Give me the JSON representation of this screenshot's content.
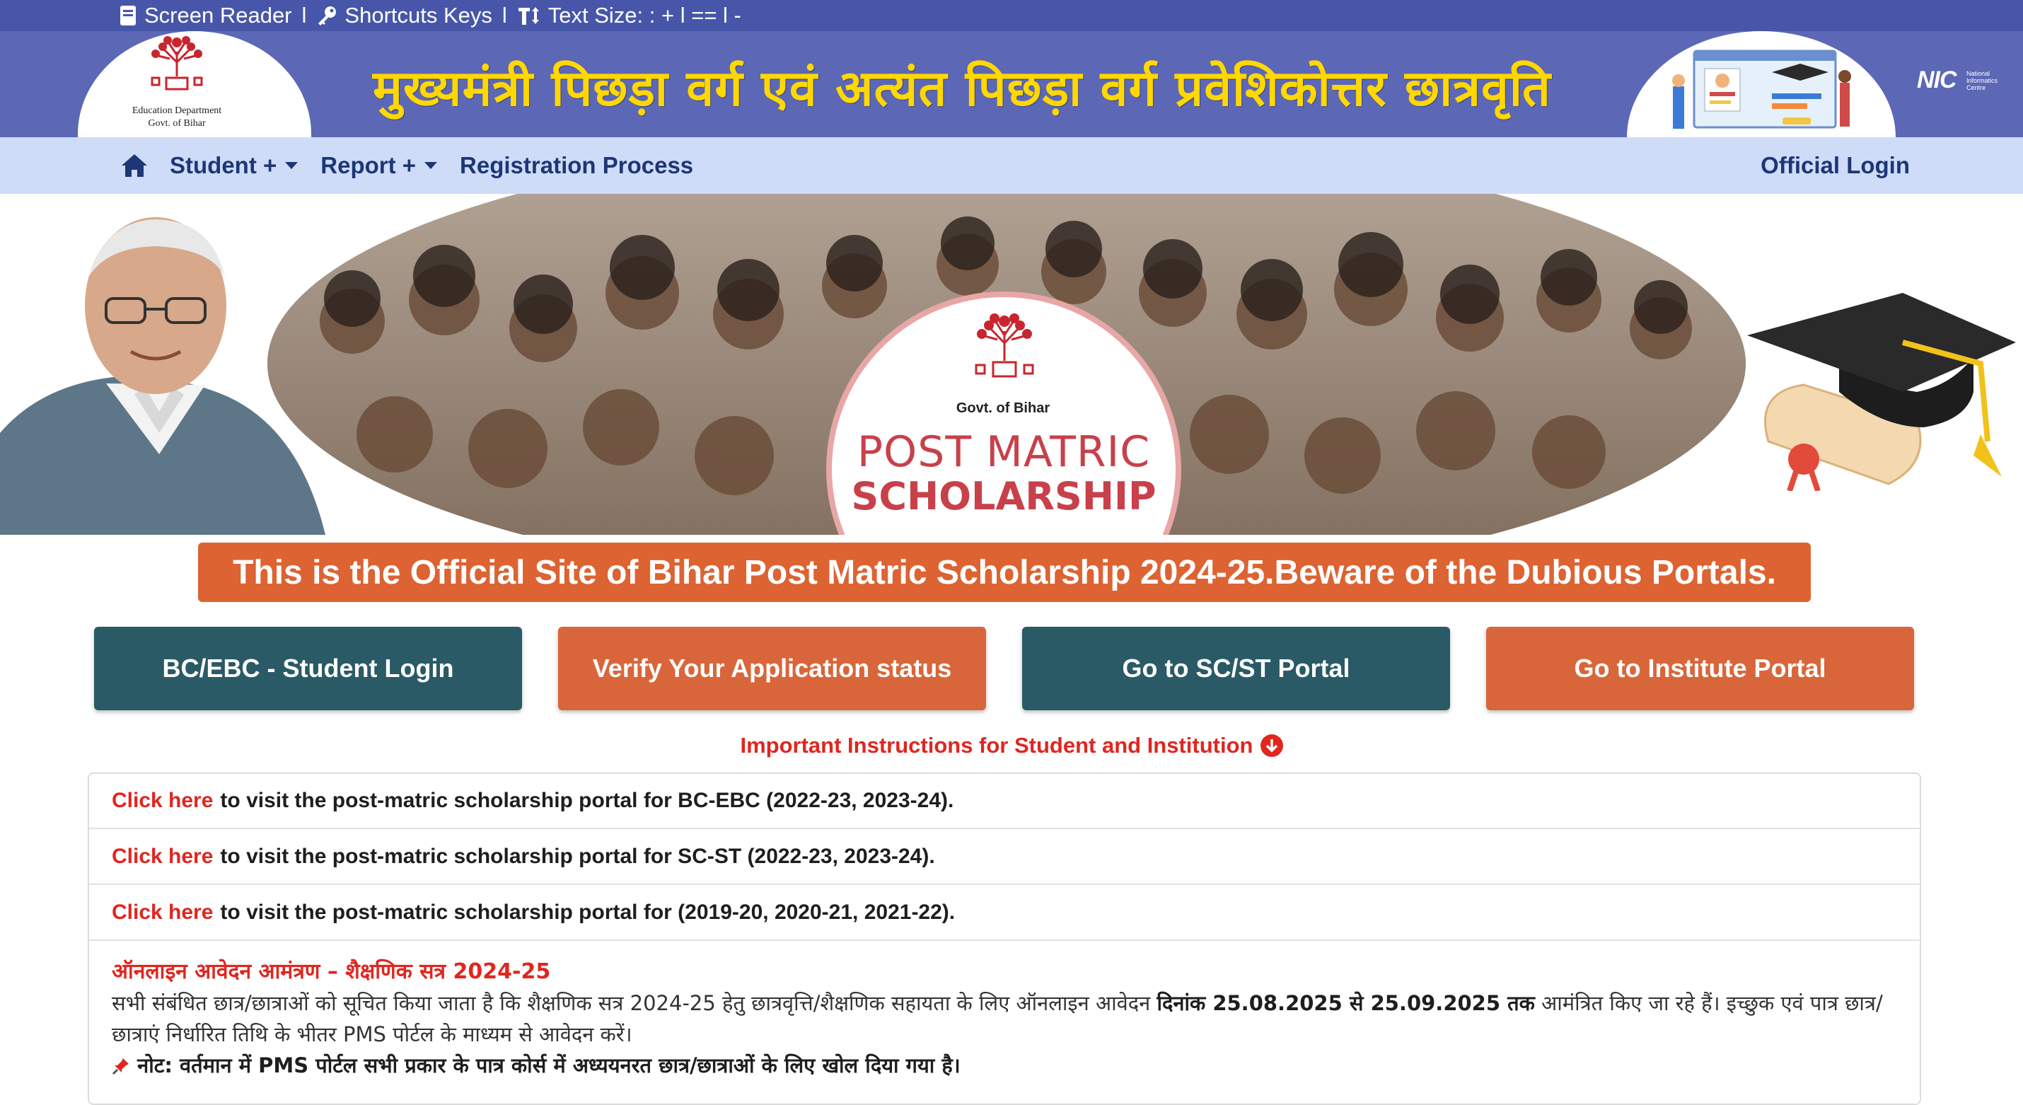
{
  "a11y": {
    "screen_reader": "Screen Reader",
    "shortcuts": "Shortcuts Keys",
    "text_size": "Text Size: : + l == l  -",
    "sep": "l"
  },
  "header": {
    "dept_line1": "Education Department",
    "dept_line2": "Govt. of Bihar",
    "title": "मुख्यमंत्री पिछड़ा वर्ग एवं अत्यंत पिछड़ा वर्ग प्रवेशिकोत्तर छात्रवृति",
    "nic_big": "NIC",
    "nic_small1": "National",
    "nic_small2": "Informatics",
    "nic_small3": "Centre"
  },
  "nav": {
    "student": "Student +",
    "report": "Report +",
    "registration": "Registration Process",
    "official_login": "Official Login"
  },
  "hero": {
    "govt": "Govt. of Bihar",
    "pm_line1": "POST MATRIC",
    "pm_line2": "SCHOLARSHIP"
  },
  "alert": "This is the Official Site of Bihar Post Matric Scholarship 2024-25.Beware of the Dubious Portals.",
  "buttons": {
    "student_login": "BC/EBC - Student Login",
    "verify": "Verify Your Application status",
    "scst": "Go to SC/ST Portal",
    "institute": "Go to Institute Portal"
  },
  "instructions": {
    "title": "Important Instructions for Student and Institution",
    "rows": [
      {
        "link": "Click here",
        "text": "to visit the post-matric scholarship portal for BC-EBC (2022-23, 2023-24)."
      },
      {
        "link": "Click here",
        "text": "to visit the post-matric scholarship portal for SC-ST (2022-23, 2023-24)."
      },
      {
        "link": "Click here",
        "text": "to visit the post-matric scholarship portal for (2019-20, 2020-21, 2021-22)."
      }
    ],
    "notice_head": "ऑनलाइन आवेदन आमंत्रण – शैक्षणिक सत्र 2024-25",
    "notice_body_1": "सभी संबंधित छात्र/छात्राओं को सूचित किया जाता है कि शैक्षणिक सत्र 2024-25 हेतु छात्रवृत्ति/शैक्षणिक सहायता के लिए ऑनलाइन आवेदन",
    "notice_dates": "दिनांक 25.08.2025 से 25.09.2025 तक",
    "notice_body_2": "आमंत्रित किए जा रहे हैं। इच्छुक एवं पात्र छात्र/",
    "notice_body_3": "छात्राएं निर्धारित तिथि के भीतर PMS पोर्टल के माध्यम से आवेदन करें।",
    "note": "नोट: वर्तमान में PMS पोर्टल सभी प्रकार के पात्र कोर्स में अध्ययनरत छात्र/छात्राओं के लिए खोल दिया गया है।"
  },
  "colors": {
    "header_bg": "#5c67b6",
    "a11y_bg": "#4756a8",
    "nav_bg": "#cfdcf8",
    "title_yellow": "#ffd800",
    "alert_orange": "#dd6332",
    "teal_button": "#2a5a66",
    "orange_button": "#d9663a",
    "link_red": "#e0261f"
  },
  "icons": [
    "book-icon",
    "key-icon",
    "text-size-icon",
    "home-icon",
    "caret-down-icon",
    "arrow-down-circle-icon",
    "pin-icon"
  ]
}
